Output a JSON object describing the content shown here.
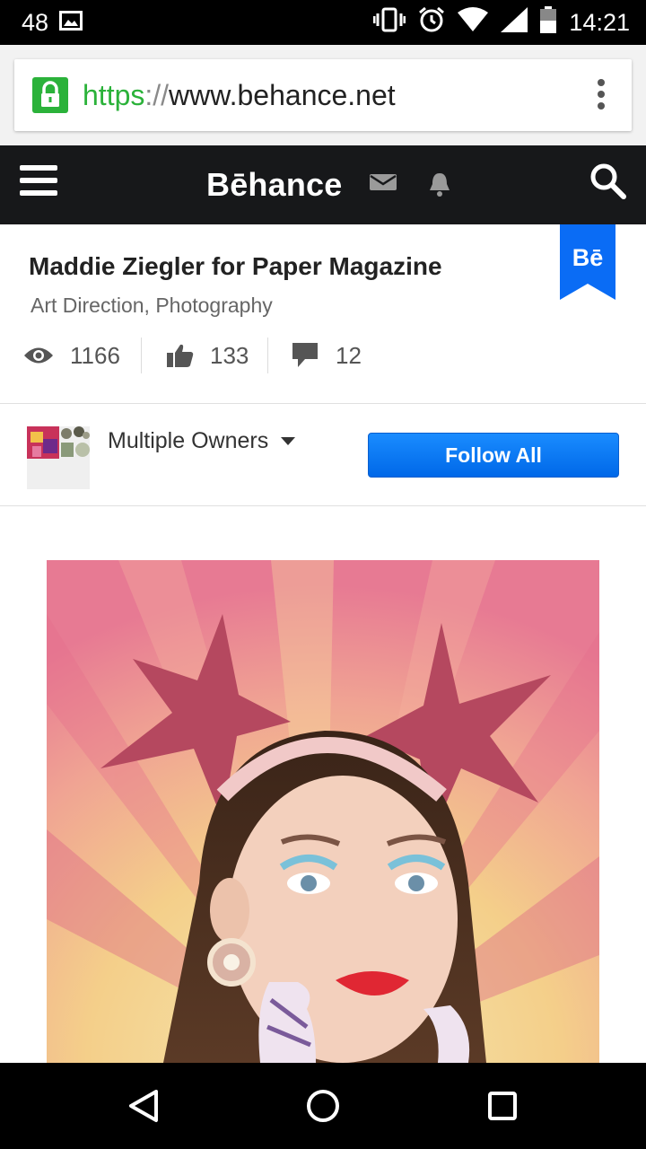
{
  "status_bar": {
    "notification_count": "48",
    "time": "14:21"
  },
  "browser": {
    "url_scheme": "https",
    "url_separator": "://",
    "url_host": "www.behance.net"
  },
  "nav": {
    "brand": "Bēhance"
  },
  "project": {
    "title": "Maddie Ziegler for Paper Magazine",
    "fields": "Art Direction, Photography",
    "ribbon_label": "Bē",
    "stats": {
      "views": "1166",
      "appreciations": "133",
      "comments": "12"
    }
  },
  "owners": {
    "label": "Multiple Owners",
    "follow_label": "Follow All"
  },
  "colors": {
    "accent": "#0a6cf5",
    "nav_bg": "#17181a",
    "lock_green": "#2bb23a"
  }
}
